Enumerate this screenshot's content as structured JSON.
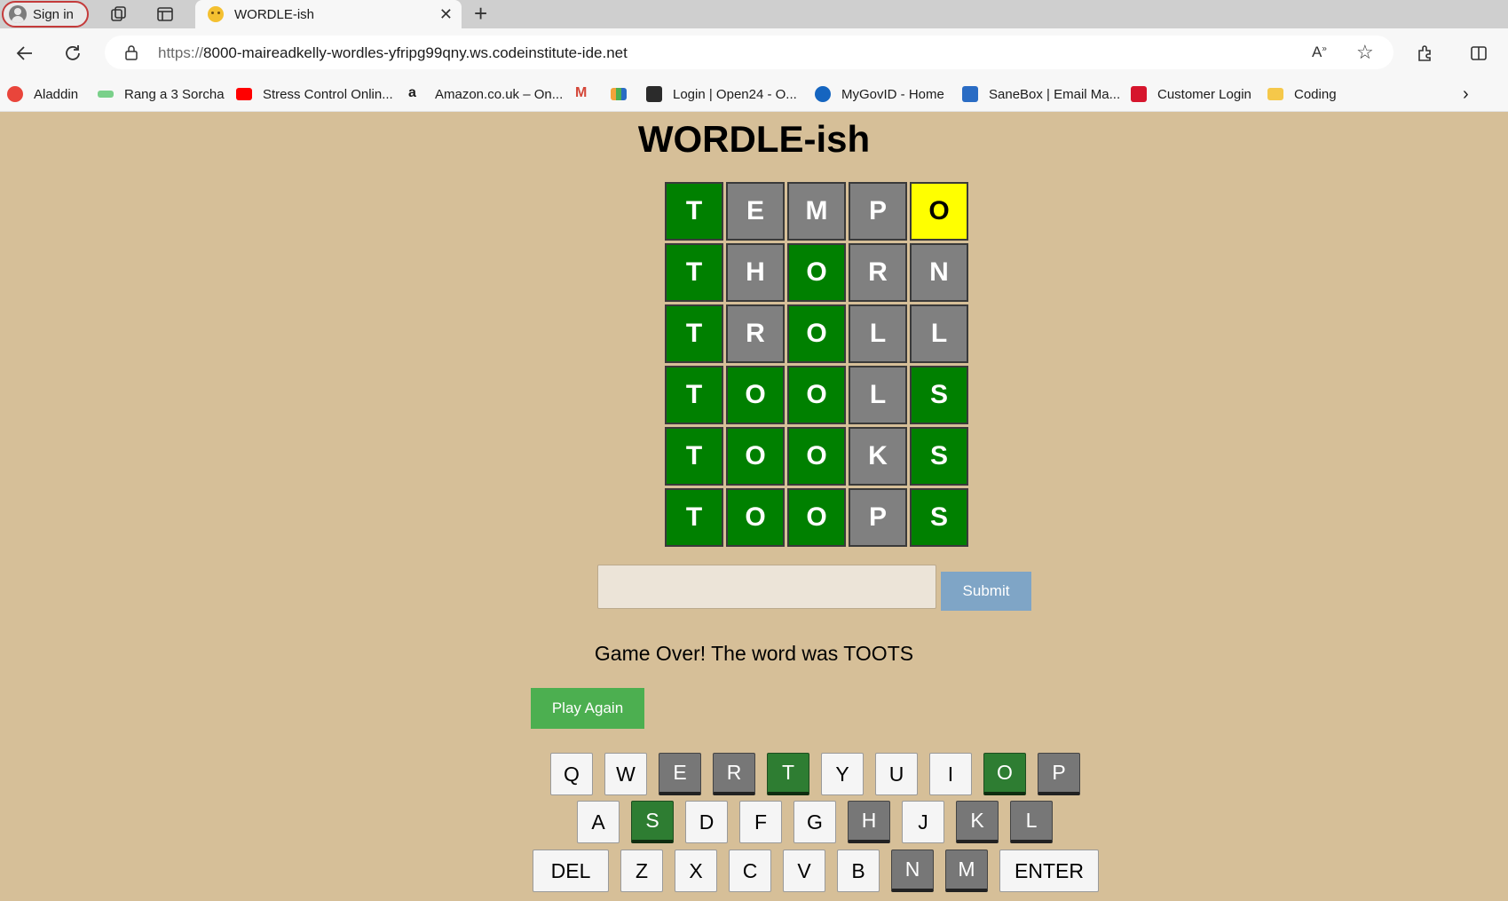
{
  "browser": {
    "signin_label": "Sign in",
    "tab_title": "WORDLE-ish",
    "url_scheme": "https://",
    "url_rest": "8000-maireadkelly-wordles-yfripg99qny.ws.codeinstitute-ide.net",
    "bookmarks": [
      {
        "label": "Aladdin",
        "icon": "aladdin-icon",
        "color": "#e9453b"
      },
      {
        "label": "Rang a 3 Sorcha",
        "icon": "bow-icon",
        "color": "#7ad08a"
      },
      {
        "label": "Stress Control Onlin...",
        "icon": "youtube-icon",
        "color": "#ff0000"
      },
      {
        "label": "Amazon.co.uk – On...",
        "icon": "amazon-icon",
        "color": "#222222"
      },
      {
        "label": "",
        "icon": "gmail-icon",
        "color": "#d44638"
      },
      {
        "label": "",
        "icon": "analytics-icon",
        "color": "#f2a33a"
      },
      {
        "label": "Login | Open24 - O...",
        "icon": "open24-icon",
        "color": "#2b2b2b"
      },
      {
        "label": "MyGovID - Home",
        "icon": "mygovid-icon",
        "color": "#1565c0"
      },
      {
        "label": "SaneBox | Email Ma...",
        "icon": "sanebox-icon",
        "color": "#2a6cc4"
      },
      {
        "label": "Customer Login",
        "icon": "customer-login-icon",
        "color": "#d6152d"
      },
      {
        "label": "Coding",
        "icon": "folder-icon",
        "color": "#f5c84a"
      }
    ]
  },
  "game": {
    "title": "WORDLE-ish",
    "rows": [
      [
        {
          "l": "T",
          "s": "green"
        },
        {
          "l": "E",
          "s": "gray"
        },
        {
          "l": "M",
          "s": "gray"
        },
        {
          "l": "P",
          "s": "gray"
        },
        {
          "l": "O",
          "s": "yellow"
        }
      ],
      [
        {
          "l": "T",
          "s": "green"
        },
        {
          "l": "H",
          "s": "gray"
        },
        {
          "l": "O",
          "s": "green"
        },
        {
          "l": "R",
          "s": "gray"
        },
        {
          "l": "N",
          "s": "gray"
        }
      ],
      [
        {
          "l": "T",
          "s": "green"
        },
        {
          "l": "R",
          "s": "gray"
        },
        {
          "l": "O",
          "s": "green"
        },
        {
          "l": "L",
          "s": "gray"
        },
        {
          "l": "L",
          "s": "gray"
        }
      ],
      [
        {
          "l": "T",
          "s": "green"
        },
        {
          "l": "O",
          "s": "green"
        },
        {
          "l": "O",
          "s": "green"
        },
        {
          "l": "L",
          "s": "gray"
        },
        {
          "l": "S",
          "s": "green"
        }
      ],
      [
        {
          "l": "T",
          "s": "green"
        },
        {
          "l": "O",
          "s": "green"
        },
        {
          "l": "O",
          "s": "green"
        },
        {
          "l": "K",
          "s": "gray"
        },
        {
          "l": "S",
          "s": "green"
        }
      ],
      [
        {
          "l": "T",
          "s": "green"
        },
        {
          "l": "O",
          "s": "green"
        },
        {
          "l": "O",
          "s": "green"
        },
        {
          "l": "P",
          "s": "gray"
        },
        {
          "l": "S",
          "s": "green"
        }
      ]
    ],
    "input_value": "",
    "submit_label": "Submit",
    "message": "Game Over! The word was TOOTS",
    "play_again_label": "Play Again",
    "keyboard": [
      [
        {
          "k": "Q",
          "s": ""
        },
        {
          "k": "W",
          "s": ""
        },
        {
          "k": "E",
          "s": "gray"
        },
        {
          "k": "R",
          "s": "gray"
        },
        {
          "k": "T",
          "s": "green"
        },
        {
          "k": "Y",
          "s": ""
        },
        {
          "k": "U",
          "s": ""
        },
        {
          "k": "I",
          "s": ""
        },
        {
          "k": "O",
          "s": "green"
        },
        {
          "k": "P",
          "s": "gray"
        }
      ],
      [
        {
          "k": "A",
          "s": ""
        },
        {
          "k": "S",
          "s": "green"
        },
        {
          "k": "D",
          "s": ""
        },
        {
          "k": "F",
          "s": ""
        },
        {
          "k": "G",
          "s": ""
        },
        {
          "k": "H",
          "s": "gray"
        },
        {
          "k": "J",
          "s": ""
        },
        {
          "k": "K",
          "s": "gray"
        },
        {
          "k": "L",
          "s": "gray"
        }
      ],
      [
        {
          "k": "DEL",
          "s": ""
        },
        {
          "k": "Z",
          "s": ""
        },
        {
          "k": "X",
          "s": ""
        },
        {
          "k": "C",
          "s": ""
        },
        {
          "k": "V",
          "s": ""
        },
        {
          "k": "B",
          "s": ""
        },
        {
          "k": "N",
          "s": "gray"
        },
        {
          "k": "M",
          "s": "gray"
        },
        {
          "k": "ENTER",
          "s": ""
        }
      ]
    ]
  }
}
